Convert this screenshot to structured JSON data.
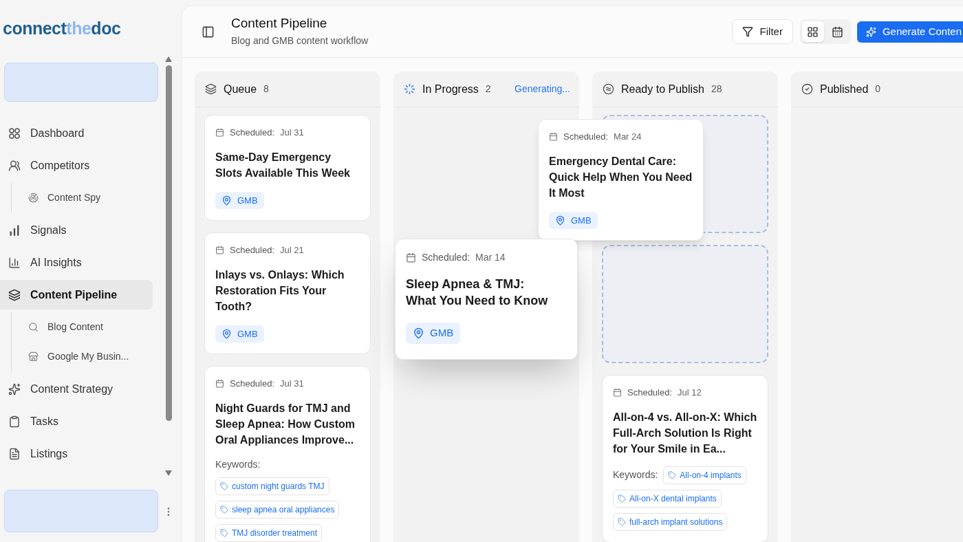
{
  "logo": {
    "parts": [
      {
        "text": "connect",
        "kind": "dark"
      },
      {
        "text": "the",
        "kind": "light"
      },
      {
        "text": "doc",
        "kind": "dark"
      }
    ]
  },
  "sidebar": {
    "items": [
      {
        "label": "Dashboard",
        "selected": false
      },
      {
        "label": "Competitors",
        "selected": false,
        "children": [
          {
            "label": "Content Spy",
            "selected": false
          }
        ]
      },
      {
        "label": "Signals",
        "selected": false
      },
      {
        "label": "AI Insights",
        "selected": false
      },
      {
        "label": "Content Pipeline",
        "selected": true,
        "children": [
          {
            "label": "Blog Content",
            "selected": false
          },
          {
            "label": "Google My Busin...",
            "selected": false
          }
        ]
      },
      {
        "label": "Content Strategy",
        "selected": false
      },
      {
        "label": "Tasks",
        "selected": false
      },
      {
        "label": "Listings",
        "selected": false
      }
    ]
  },
  "header": {
    "title": "Content Pipeline",
    "subtitle": "Blog and GMB content workflow",
    "filter_button": "Filter",
    "views": [
      {
        "kind": "grid",
        "selected": true
      },
      {
        "kind": "calendar",
        "selected": false
      }
    ],
    "generate_button": "Generate Conten"
  },
  "columns": [
    {
      "kind": "queue",
      "title": "Queue",
      "count": "8",
      "cards": [
        {
          "kind": "card",
          "scheduled_label": "Scheduled:",
          "date": "Jul 31",
          "title": "Same-Day Emergency Slots Available This Week",
          "tags": [
            "GMB"
          ]
        },
        {
          "kind": "card",
          "scheduled_label": "Scheduled:",
          "date": "Jul 21",
          "title": "Inlays vs. Onlays: Which Restoration Fits Your Tooth?",
          "tags": [
            "GMB"
          ]
        },
        {
          "kind": "card",
          "scheduled_label": "Scheduled:",
          "date": "Jul 31",
          "title": "Night Guards for TMJ and Sleep Apnea: How Custom Oral Appliances Improve...",
          "keywords_label": "Keywords:",
          "keywords": [
            "custom night guards TMJ",
            "sleep apnea oral appliances",
            "TMJ disorder treatment"
          ]
        }
      ]
    },
    {
      "kind": "progress",
      "title": "In Progress",
      "count": "2",
      "status": "Generating..."
    },
    {
      "kind": "ready",
      "title": "Ready to Publish",
      "count": "28",
      "cards": [
        {
          "kind": "placeholder"
        },
        {
          "kind": "placeholder"
        },
        {
          "kind": "card",
          "scheduled_label": "Scheduled:",
          "date": "Jul 12",
          "title": "All-on-4 vs. All-on-X: Which Full-Arch Solution Is Right for Your Smile in Ea...",
          "keywords_label": "Keywords:",
          "keywords": [
            "All-on-4 implants",
            "All-on-X dental implants",
            "full-arch implant solutions"
          ]
        }
      ]
    },
    {
      "kind": "published",
      "title": "Published",
      "count": "0"
    }
  ],
  "dragging": [
    {
      "kind": "small",
      "scheduled_label": "Scheduled:",
      "date": "Mar 24",
      "title": "Emergency Dental Care: Quick Help When You Need It Most",
      "tags": [
        "GMB"
      ]
    },
    {
      "kind": "large",
      "scheduled_label": "Scheduled:",
      "date": "Mar 14",
      "title": "Sleep Apnea & TMJ: What You Need to Know",
      "tags": [
        "GMB"
      ]
    }
  ]
}
